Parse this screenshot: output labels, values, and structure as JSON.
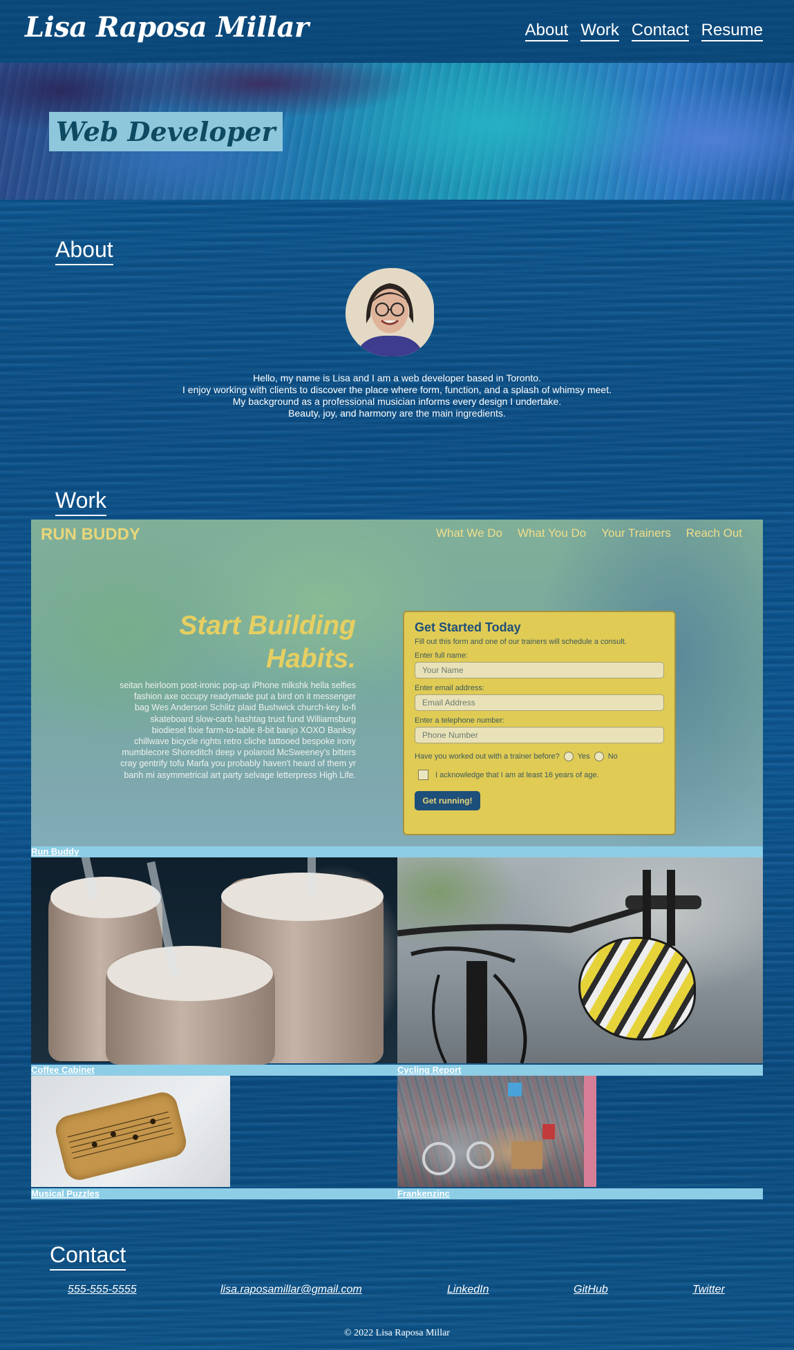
{
  "header": {
    "site_title": "Lisa Raposa Millar",
    "nav": [
      {
        "label": "About"
      },
      {
        "label": "Work"
      },
      {
        "label": "Contact"
      },
      {
        "label": "Resume"
      }
    ]
  },
  "hero": {
    "badge": "Web Developer"
  },
  "about": {
    "heading": "About",
    "avatar_icon": "avatar-photo",
    "lines": [
      "Hello, my name is Lisa and I am a web developer based in Toronto.",
      "I enjoy working with clients to discover the place where form, function, and a splash of whimsy meet.",
      "My background as a professional musician informs every design I undertake.",
      "Beauty, joy, and harmony are the main ingredients."
    ]
  },
  "work": {
    "heading": "Work",
    "projects": [
      {
        "title": "Run Buddy"
      },
      {
        "title": "Coffee Cabinet"
      },
      {
        "title": "Cycling Report"
      },
      {
        "title": "Musical Puzzles"
      },
      {
        "title": "Frankenzinc"
      }
    ],
    "run_buddy_preview": {
      "logo": "RUN BUDDY",
      "nav": [
        "What We Do",
        "What You Do",
        "Your Trainers",
        "Reach Out"
      ],
      "headline_1": "Start Building",
      "headline_2": "Habits.",
      "lorem": "seitan heirloom post-ironic pop-up iPhone mlkshk hella selfies fashion axe occupy readymade put a bird on it messenger bag Wes Anderson Schlitz plaid Bushwick church-key lo-fi skateboard slow-carb hashtag trust fund Williamsburg biodiesel fixie farm-to-table 8-bit banjo XOXO Banksy chillwave bicycle rights retro cliche tattooed bespoke irony mumblecore Shoreditch deep v polaroid McSweeney's bitters cray gentrify tofu Marfa you probably haven't heard of them yr banh mi asymmetrical art party selvage letterpress High Life.",
      "form_title": "Get Started Today",
      "form_sub": "Fill out this form and one of our trainers will schedule a consult.",
      "name_label": "Enter full name:",
      "name_placeholder": "Your Name",
      "email_label": "Enter email address:",
      "email_placeholder": "Email Address",
      "phone_label": "Enter a telephone number:",
      "phone_placeholder": "Phone Number",
      "radio_question": "Have you worked out with a trainer before?",
      "radio_yes": "Yes",
      "radio_no": "No",
      "checkbox_label": "I acknowledge that I am at least 16 years of age.",
      "submit_label": "Get running!"
    }
  },
  "contact": {
    "heading": "Contact",
    "links": [
      {
        "label": "555-555-5555"
      },
      {
        "label": "lisa.raposamillar@gmail.com"
      },
      {
        "label": "LinkedIn"
      },
      {
        "label": "GitHub"
      },
      {
        "label": "Twitter"
      }
    ]
  },
  "footer": {
    "text": "© 2022 Lisa Raposa Millar"
  }
}
